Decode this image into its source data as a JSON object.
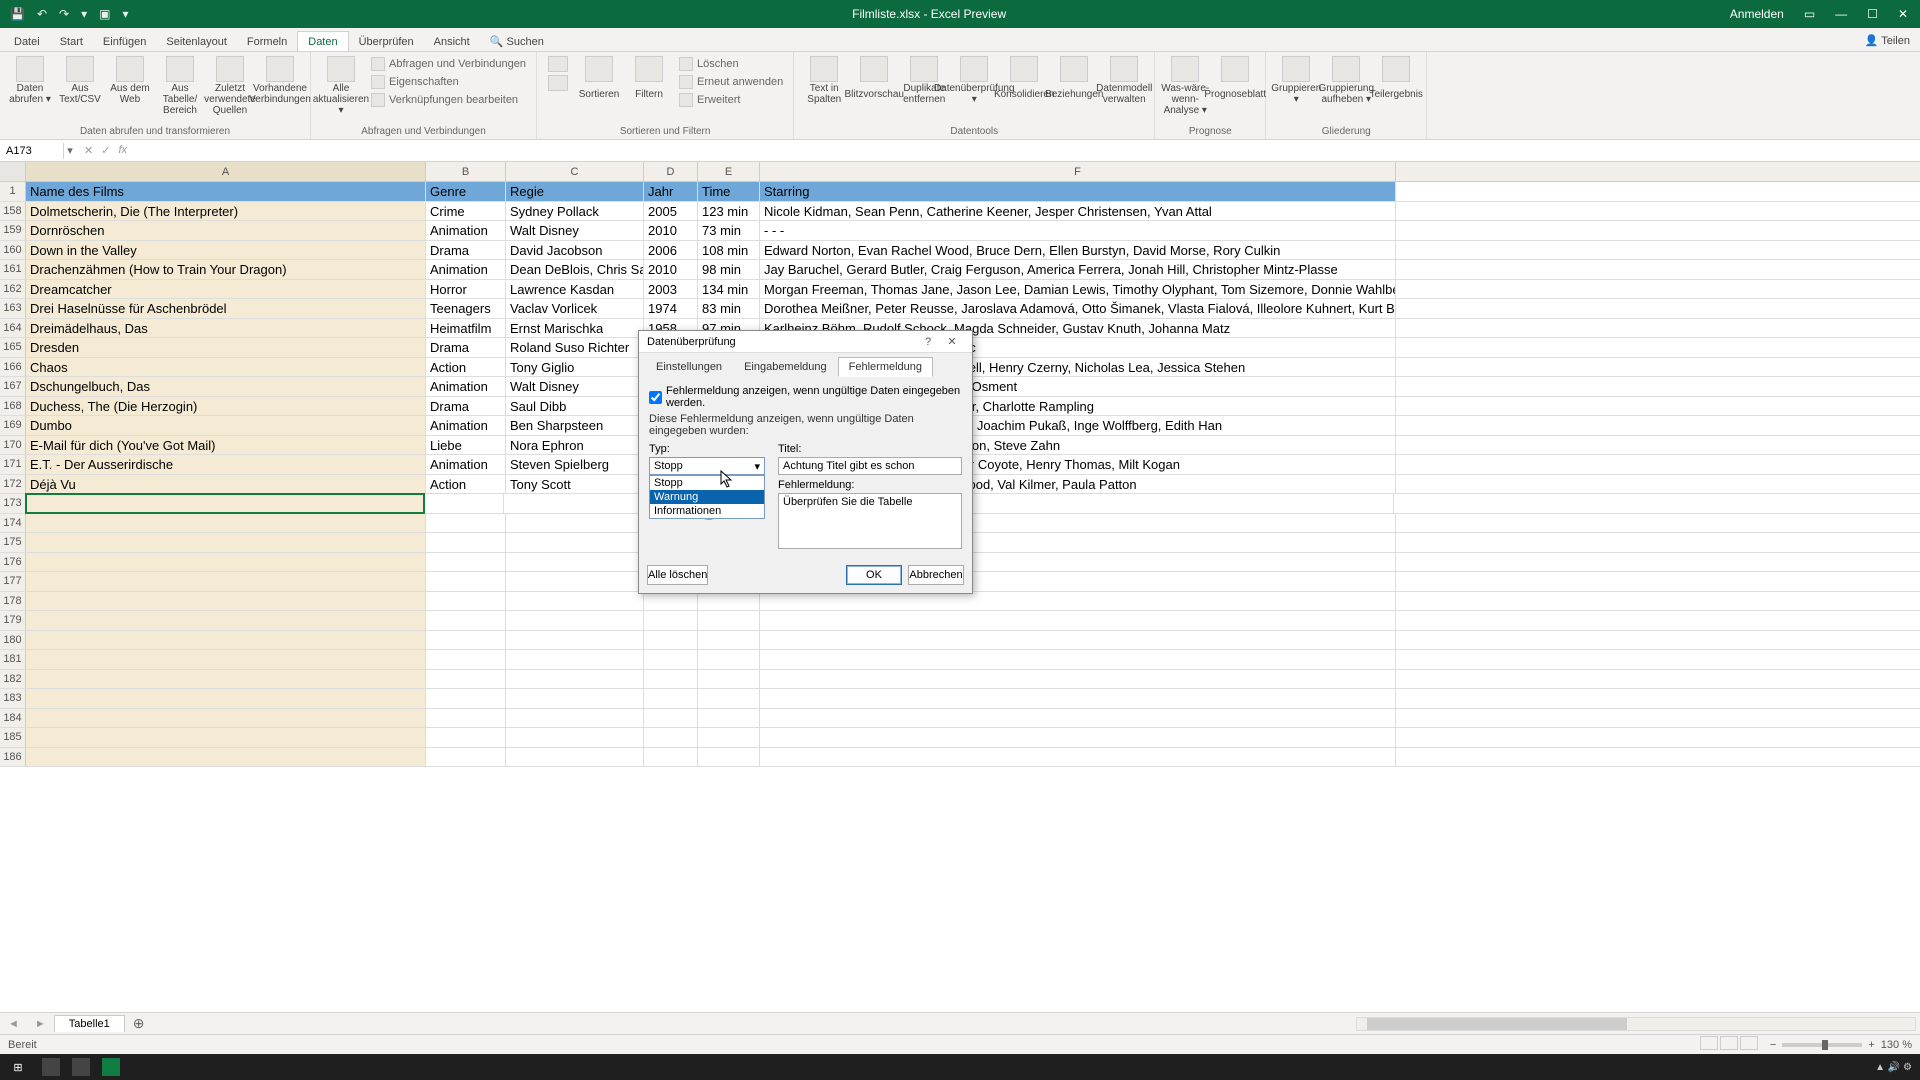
{
  "titlebar": {
    "title": "Filmliste.xlsx - Excel Preview",
    "signin": "Anmelden"
  },
  "tabs": {
    "file": "Datei",
    "home": "Start",
    "insert": "Einfügen",
    "layout": "Seitenlayout",
    "formulas": "Formeln",
    "data": "Daten",
    "review": "Überprüfen",
    "view": "Ansicht",
    "search": "Suchen",
    "share": "Teilen"
  },
  "ribbon": {
    "group1": {
      "label": "Daten abrufen und transformieren",
      "b1": "Daten abrufen ▾",
      "b2": "Aus Text/CSV",
      "b3": "Aus dem Web",
      "b4": "Aus Tabelle/ Bereich",
      "b5": "Zuletzt verwendete Quellen",
      "b6": "Vorhandene Verbindungen"
    },
    "group2": {
      "label": "Abfragen und Verbindungen",
      "b1": "Alle aktualisieren ▾",
      "s1": "Abfragen und Verbindungen",
      "s2": "Eigenschaften",
      "s3": "Verknüpfungen bearbeiten"
    },
    "group3": {
      "label": "Sortieren und Filtern",
      "b1": "Sortieren",
      "b2": "Filtern",
      "s1": "Löschen",
      "s2": "Erneut anwenden",
      "s3": "Erweitert"
    },
    "group4": {
      "label": "Datentools",
      "b1": "Text in Spalten",
      "b2": "Blitzvorschau",
      "b3": "Duplikate entfernen",
      "b4": "Datenüberprüfung ▾",
      "b5": "Konsolidieren",
      "b6": "Beziehungen",
      "b7": "Datenmodell verwalten"
    },
    "group5": {
      "label": "Prognose",
      "b1": "Was-wäre-wenn- Analyse ▾",
      "b2": "Prognoseblatt"
    },
    "group6": {
      "label": "Gliederung",
      "b1": "Gruppieren ▾",
      "b2": "Gruppierung aufheben ▾",
      "b3": "Teilergebnis"
    }
  },
  "namebox": "A173",
  "columns": {
    "A": "A",
    "B": "B",
    "C": "C",
    "D": "D",
    "E": "E",
    "F": "F"
  },
  "header": {
    "A": "Name des Films",
    "B": "Genre",
    "C": "Regie",
    "D": "Jahr",
    "E": "Time",
    "F": "Starring"
  },
  "rows": [
    {
      "n": "158",
      "A": "Dolmetscherin, Die (The Interpreter)",
      "B": "Crime",
      "C": "Sydney Pollack",
      "D": "2005",
      "E": "123 min",
      "F": "Nicole Kidman, Sean Penn, Catherine Keener, Jesper Christensen, Yvan Attal"
    },
    {
      "n": "159",
      "A": "Dornröschen",
      "B": "Animation",
      "C": "Walt Disney",
      "D": "2010",
      "E": "73 min",
      "F": "- - -"
    },
    {
      "n": "160",
      "A": "Down in the Valley",
      "B": "Drama",
      "C": "David Jacobson",
      "D": "2006",
      "E": "108 min",
      "F": "Edward Norton, Evan Rachel Wood, Bruce Dern, Ellen Burstyn, David Morse, Rory Culkin"
    },
    {
      "n": "161",
      "A": "Drachenzähmen (How to Train Your Dragon)",
      "B": "Animation",
      "C": "Dean DeBlois, Chris Sanders",
      "D": "2010",
      "E": "98 min",
      "F": "Jay Baruchel, Gerard Butler, Craig Ferguson, America Ferrera, Jonah Hill, Christopher Mintz-Plasse"
    },
    {
      "n": "162",
      "A": "Dreamcatcher",
      "B": "Horror",
      "C": "Lawrence Kasdan",
      "D": "2003",
      "E": "134 min",
      "F": "Morgan Freeman, Thomas Jane, Jason Lee, Damian Lewis, Timothy Olyphant, Tom Sizemore, Donnie Wahlber"
    },
    {
      "n": "163",
      "A": "Drei Haselnüsse für Aschenbrödel",
      "B": "Teenagers",
      "C": "Vaclav Vorlicek",
      "D": "1974",
      "E": "83 min",
      "F": "Dorothea Meißner, Peter Reusse, Jaroslava Adamová, Otto Šimanek, Vlasta Fialová, Illeolore Kuhnert, Kurt Bö"
    },
    {
      "n": "164",
      "A": "Dreimädelhaus, Das",
      "B": "Heimatfilm",
      "C": "Ernst Marischka",
      "D": "1958",
      "E": "97 min",
      "F": "Karlheinz Böhm, Rudolf Schock, Magda Schneider, Gustav Knuth, Johanna Matz"
    },
    {
      "n": "165",
      "A": "Dresden",
      "B": "Drama",
      "C": "Roland Suso Richter",
      "D": "",
      "E": "",
      "F": "ll, John Light, Heiner Lauterbach, etc"
    },
    {
      "n": "166",
      "A": "Chaos",
      "B": "Action",
      "C": "Tony Giglio",
      "D": "",
      "E": "",
      "F": "tham, Ryan Phillippe, Justine Waddell, Henry Czerny, Nicholas Lea, Jessica Stehen"
    },
    {
      "n": "167",
      "A": "Dschungelbuch, Das",
      "B": "Animation",
      "C": "Walt Disney",
      "D": "",
      "E": "",
      "F": "en, Tony Jay, Bob Joles, Haley Joel Osment"
    },
    {
      "n": "168",
      "A": "Duchess, The (Die Herzogin)",
      "B": "Drama",
      "C": "Saul Dibb",
      "D": "",
      "E": "",
      "F": "s, Simon McBurney, Dominic Cooper, Charlotte Rampling"
    },
    {
      "n": "169",
      "A": "Dumbo",
      "B": "Animation",
      "C": "Ben Sharpsteen",
      "D": "",
      "E": "",
      "F": "opff, Wilfried Herbst, Gerd Holtenau, Joachim Pukaß, Inge Wolffberg, Edith Han"
    },
    {
      "n": "170",
      "A": "E-Mail für dich (You've Got Mail)",
      "B": "Liebe",
      "C": "Nora Ephron",
      "D": "",
      "E": "",
      "F": "Kinnear, Parker Posey, Jean Stapleton, Steve Zahn"
    },
    {
      "n": "171",
      "A": "E.T. - Der Ausserirdische",
      "B": "Animation",
      "C": "Steven Spielberg",
      "D": "",
      "E": "",
      "F": "acNaughton, Drew Barrymore, Peter Coyote, Henry Thomas, Milt Kogan"
    },
    {
      "n": "172",
      "A": "Déjà Vu",
      "B": "Action",
      "C": "Tony Scott",
      "D": "",
      "E": "",
      "F": "zel, Adam Goldberg, Bruce Greenwood, Val Kilmer, Paula Patton"
    }
  ],
  "emptyrows": [
    "173",
    "174",
    "175",
    "176",
    "177",
    "178",
    "179",
    "180",
    "181",
    "182",
    "183",
    "184",
    "185",
    "186"
  ],
  "sheet": {
    "tab": "Tabelle1"
  },
  "status": {
    "ready": "Bereit",
    "zoom": "130 %"
  },
  "dialog": {
    "title": "Datenüberprüfung",
    "tabs": {
      "t1": "Einstellungen",
      "t2": "Eingabemeldung",
      "t3": "Fehlermeldung"
    },
    "check": "Fehlermeldung anzeigen, wenn ungültige Daten eingegeben werden.",
    "subtitle": "Diese Fehlermeldung anzeigen, wenn ungültige Daten eingegeben wurden:",
    "type_lbl": "Typ:",
    "type_val": "Stopp",
    "opts": {
      "o1": "Stopp",
      "o2": "Warnung",
      "o3": "Informationen"
    },
    "title_lbl": "Titel:",
    "title_val": "Achtung Titel gibt es schon",
    "msg_lbl": "Fehlermeldung:",
    "msg_val": "Überprüfen Sie die Tabelle",
    "clear": "Alle löschen",
    "ok": "OK",
    "cancel": "Abbrechen"
  }
}
